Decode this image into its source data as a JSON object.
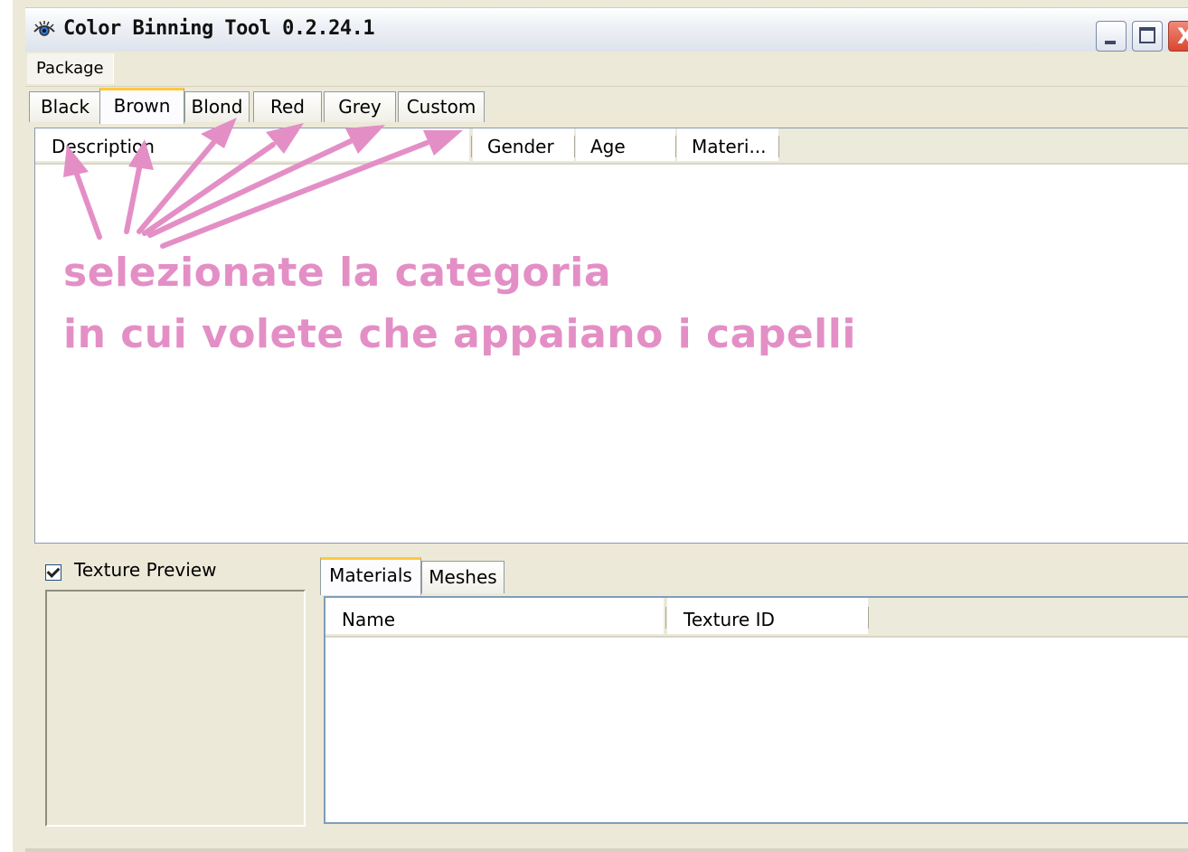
{
  "window": {
    "title": "Color Binning Tool 0.2.24.1",
    "close_glyph": "X"
  },
  "menu": {
    "items": [
      "Package"
    ]
  },
  "category_tabs": {
    "items": [
      "Black",
      "Brown",
      "Blond",
      "Red",
      "Grey",
      "Custom"
    ],
    "active": "Brown"
  },
  "item_list": {
    "columns": [
      "Description",
      "Gender",
      "Age",
      "Materi..."
    ]
  },
  "annotation": {
    "line1": "selezionate la categoria",
    "line2": "in cui volete che appaiano i capelli",
    "color": "#e38fc6"
  },
  "texture_preview": {
    "label": "Texture Preview",
    "checked": true
  },
  "detail_tabs": {
    "items": [
      "Materials",
      "Meshes"
    ],
    "active": "Materials"
  },
  "materials_table": {
    "columns": [
      "Name",
      "Texture ID"
    ]
  },
  "icons": {
    "app": "eye-icon",
    "minimize": "minimize-icon",
    "maximize": "maximize-icon",
    "close": "close-icon"
  },
  "colors": {
    "tab_accent": "#ffc83c",
    "window_bg": "#ece9d8",
    "close_button": "#d9472e"
  }
}
